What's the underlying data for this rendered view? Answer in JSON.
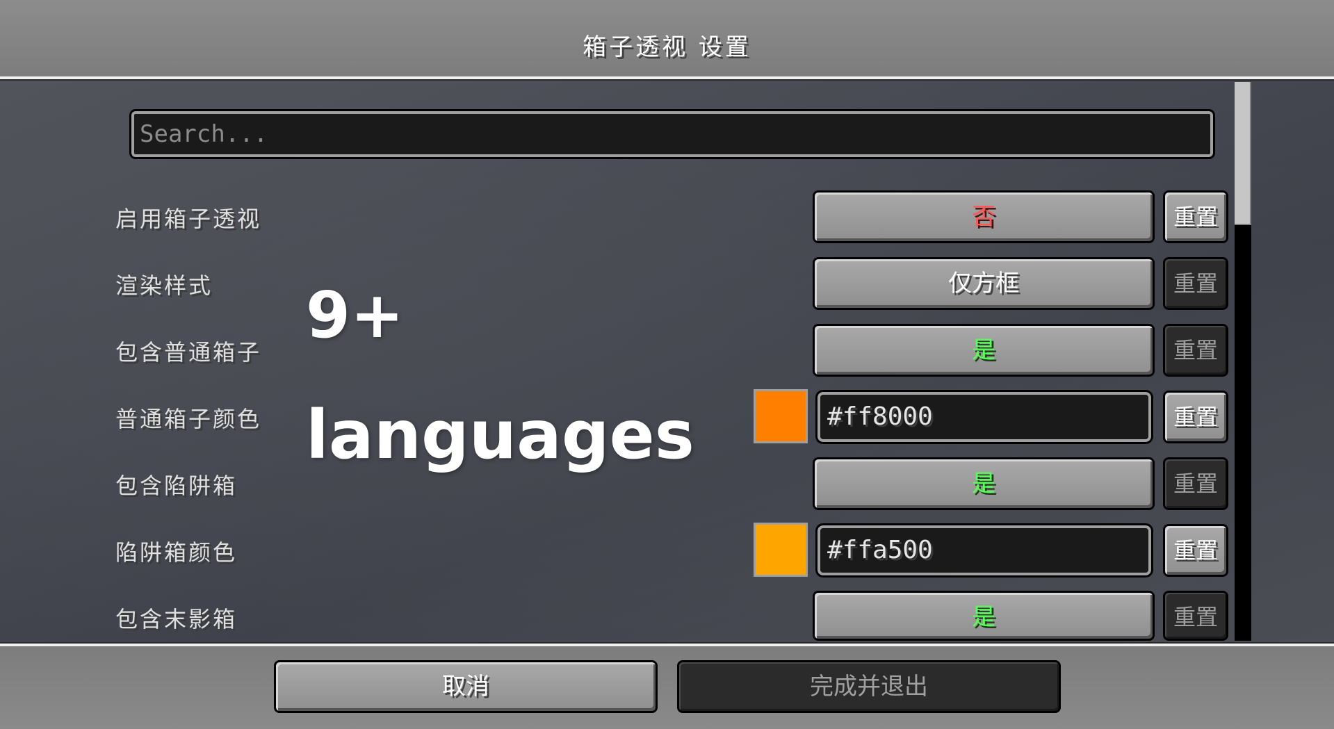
{
  "title": "箱子透视 设置",
  "search": {
    "placeholder": "Search..."
  },
  "rows": [
    {
      "label": "启用箱子透视",
      "value": "否",
      "reset": "重置"
    },
    {
      "label": "渲染样式",
      "value": "仅方框",
      "reset": "重置"
    },
    {
      "label": "包含普通箱子",
      "value": "是",
      "reset": "重置"
    },
    {
      "label": "普通箱子颜色",
      "value": "#ff8000",
      "color": "#ff8000",
      "reset": "重置"
    },
    {
      "label": "包含陷阱箱",
      "value": "是",
      "reset": "重置"
    },
    {
      "label": "陷阱箱颜色",
      "value": "#ffa500",
      "color": "#ffa500",
      "reset": "重置"
    },
    {
      "label": "包含末影箱",
      "value": "是",
      "reset": "重置"
    }
  ],
  "overlay": {
    "count": "9+",
    "word": "languages"
  },
  "footer": {
    "cancel": "取消",
    "done": "完成并退出"
  }
}
